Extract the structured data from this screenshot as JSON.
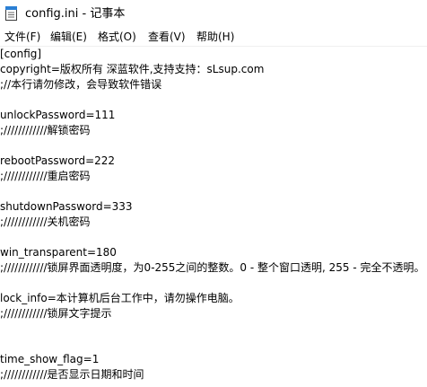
{
  "window": {
    "title": "config.ini - 记事本",
    "icon": "notepad-icon"
  },
  "menubar": {
    "items": [
      {
        "label": "文件(F)"
      },
      {
        "label": "编辑(E)"
      },
      {
        "label": "格式(O)"
      },
      {
        "label": "查看(V)"
      },
      {
        "label": "帮助(H)"
      }
    ]
  },
  "editor": {
    "lines": [
      "[config]",
      "copyright=版权所有 深蓝软件,支持支持：sLsup.com",
      ";//本行请勿修改，会导致软件错误",
      "",
      "unlockPassword=111",
      ";////////////解锁密码",
      "",
      "rebootPassword=222",
      ";////////////重启密码",
      "",
      "shutdownPassword=333",
      ";////////////关机密码",
      "",
      "win_transparent=180",
      ";////////////锁屏界面透明度，为0-255之间的整数。0 - 整个窗口透明, 255 - 完全不透明。",
      "",
      "lock_info=本计算机后台工作中，请勿操作电脑。",
      ";////////////锁屏文字提示",
      "",
      "",
      "time_show_flag=1",
      ";////////////是否显示日期和时间"
    ]
  }
}
